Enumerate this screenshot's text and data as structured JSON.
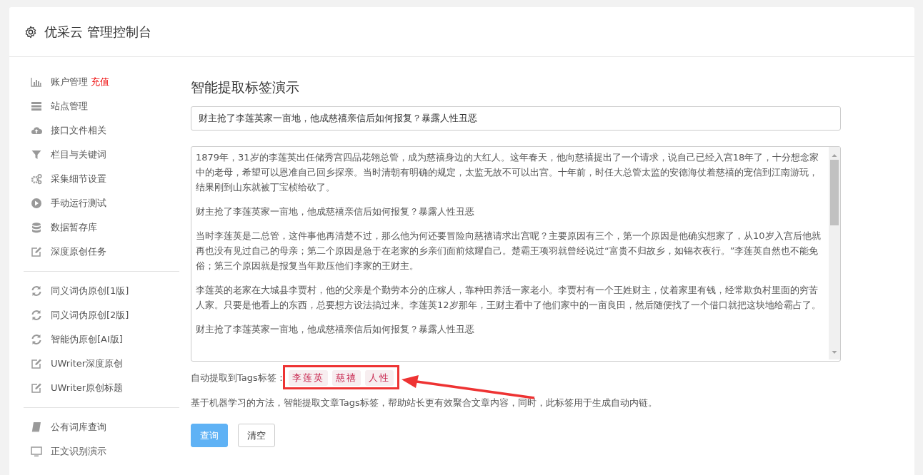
{
  "header": {
    "title": "优采云 管理控制台"
  },
  "sidebar": {
    "groups": [
      {
        "items": [
          {
            "label": "账户管理",
            "badge": "充值"
          },
          {
            "label": "站点管理"
          },
          {
            "label": "接口文件相关"
          },
          {
            "label": "栏目与关键词"
          },
          {
            "label": "采集细节设置"
          },
          {
            "label": "手动运行测试"
          },
          {
            "label": "数据暂存库"
          },
          {
            "label": "深度原创任务"
          }
        ]
      },
      {
        "items": [
          {
            "label": "同义词伪原创[1版]"
          },
          {
            "label": "同义词伪原创[2版]"
          },
          {
            "label": "智能伪原创[AI版]"
          },
          {
            "label": "UWriter深度原创"
          },
          {
            "label": "UWriter原创标题"
          }
        ]
      },
      {
        "items": [
          {
            "label": "公有词库查询"
          },
          {
            "label": "正文识别演示"
          }
        ]
      }
    ]
  },
  "main": {
    "heading": "智能提取标签演示",
    "title_field": {
      "value": "财主抢了李莲英家一亩地，他成慈禧亲信后如何报复？暴露人性丑恶"
    },
    "content_paragraphs": [
      "1879年，31岁的李莲英出任储秀宫四品花翎总管，成为慈禧身边的大红人。这年春天，他向慈禧提出了一个请求，说自己已经入宫18年了，十分想念家中的老母，希望可以恩准自己回乡探亲。当时清朝有明确的规定，太监无故不可以出宫。十年前，时任大总管太监的安德海仗着慈禧的宠信到江南游玩，结果刚到山东就被丁宝桢给砍了。",
      "财主抢了李莲英家一亩地，他成慈禧亲信后如何报复？暴露人性丑恶",
      "当时李莲英是二总管，这件事他再清楚不过，那么他为何还要冒险向慈禧请求出宫呢？主要原因有三个，第一个原因是他确实想家了，从10岁入宫后他就再也没有见过自己的母亲；第二个原因是急于在老家的乡亲们面前炫耀自己。楚霸王项羽就曾经说过“富贵不归故乡，如锦衣夜行。”李莲英自然也不能免俗；第三个原因就是报复当年欺压他们李家的王财主。",
      "李莲英的老家在大城县李贾村，他的父亲是个勤劳本分的庄稼人，靠种田养活一家老小。李贾村有一个王姓财主，仗着家里有钱，经常欺负村里面的穷苦人家。只要是他看上的东西，总要想方设法搞过来。李莲英12岁那年，王财主看中了他们家中的一亩良田，然后随便找了一个借口就把这块地给霸占了。",
      "财主抢了李莲英家一亩地，他成慈禧亲信后如何报复？暴露人性丑恶"
    ],
    "tags_label": "自动提取到Tags标签：",
    "tags": [
      "李莲英",
      "慈禧",
      "人性"
    ],
    "description": "基于机器学习的方法，智能提取文章Tags标签，帮助站长更有效聚合文章内容，同时，此标签用于生成自动内链。",
    "buttons": [
      {
        "label": "查询",
        "kind": "primary"
      },
      {
        "label": "清空",
        "kind": "default"
      }
    ]
  }
}
